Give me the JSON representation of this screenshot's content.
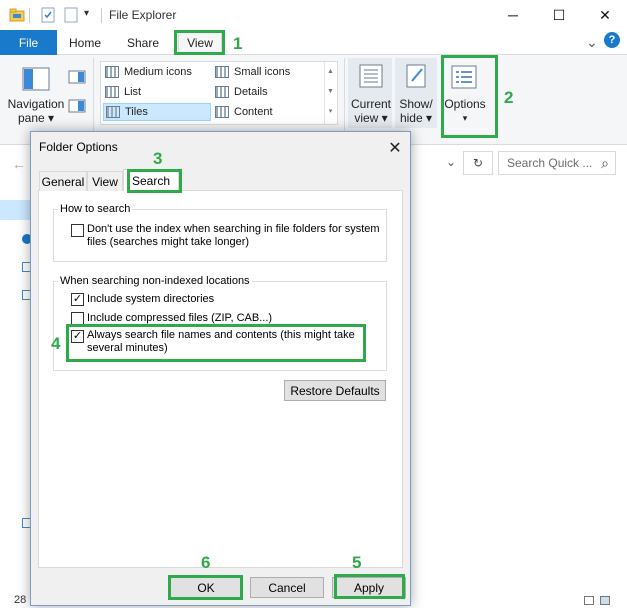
{
  "window": {
    "title": "File Explorer",
    "controls": {
      "minimize": "─",
      "maximize": "☐",
      "close": "✕"
    },
    "help_glyph": "?",
    "expand_glyph": "⌄"
  },
  "ribbon": {
    "tabs": [
      "File",
      "Home",
      "Share",
      "View"
    ],
    "navigation_pane": {
      "label_line1": "Navigation",
      "label_line2": "pane ▾"
    },
    "layout_items": [
      [
        "Medium icons",
        "Small icons"
      ],
      [
        "List",
        "Details"
      ],
      [
        "Tiles",
        "Content"
      ]
    ],
    "current_view": {
      "line1": "Current",
      "line2": "view ▾"
    },
    "show_hide": {
      "line1": "Show/",
      "line2": "hide ▾"
    },
    "options": {
      "label": "Options",
      "arrow": "▾"
    }
  },
  "address": {
    "search_placeholder": "Search Quick ...",
    "search_icon": "⌕",
    "refresh_icon": "↻",
    "dropdown_icon": "⌄",
    "back_icon": "←"
  },
  "dialog": {
    "title": "Folder Options",
    "close": "✕",
    "tabs": [
      "General",
      "View",
      "Search"
    ],
    "how_to_search": {
      "title": "How to search",
      "items": [
        {
          "label_line1": "Don't use the index when searching in file folders for system",
          "label_line2": "files (searches might take longer)",
          "checked": false
        }
      ]
    },
    "non_indexed": {
      "title": "When searching non-indexed locations",
      "items": [
        {
          "label_line1": "Include system directories",
          "label_line2": "",
          "checked": true
        },
        {
          "label_line1": "Include compressed files (ZIP, CAB...)",
          "label_line2": "",
          "checked": false
        },
        {
          "label_line1": "Always search file names and contents (this might take",
          "label_line2": "several minutes)",
          "checked": true
        }
      ]
    },
    "check_glyph": "✓",
    "restore_defaults": "Restore Defaults",
    "ok": "OK",
    "cancel": "Cancel",
    "apply": "Apply"
  },
  "status": {
    "count": "28"
  },
  "annotations": {
    "n1": "1",
    "n2": "2",
    "n3": "3",
    "n4": "4",
    "n5": "5",
    "n6": "6",
    "color": "#2eaa4a"
  }
}
